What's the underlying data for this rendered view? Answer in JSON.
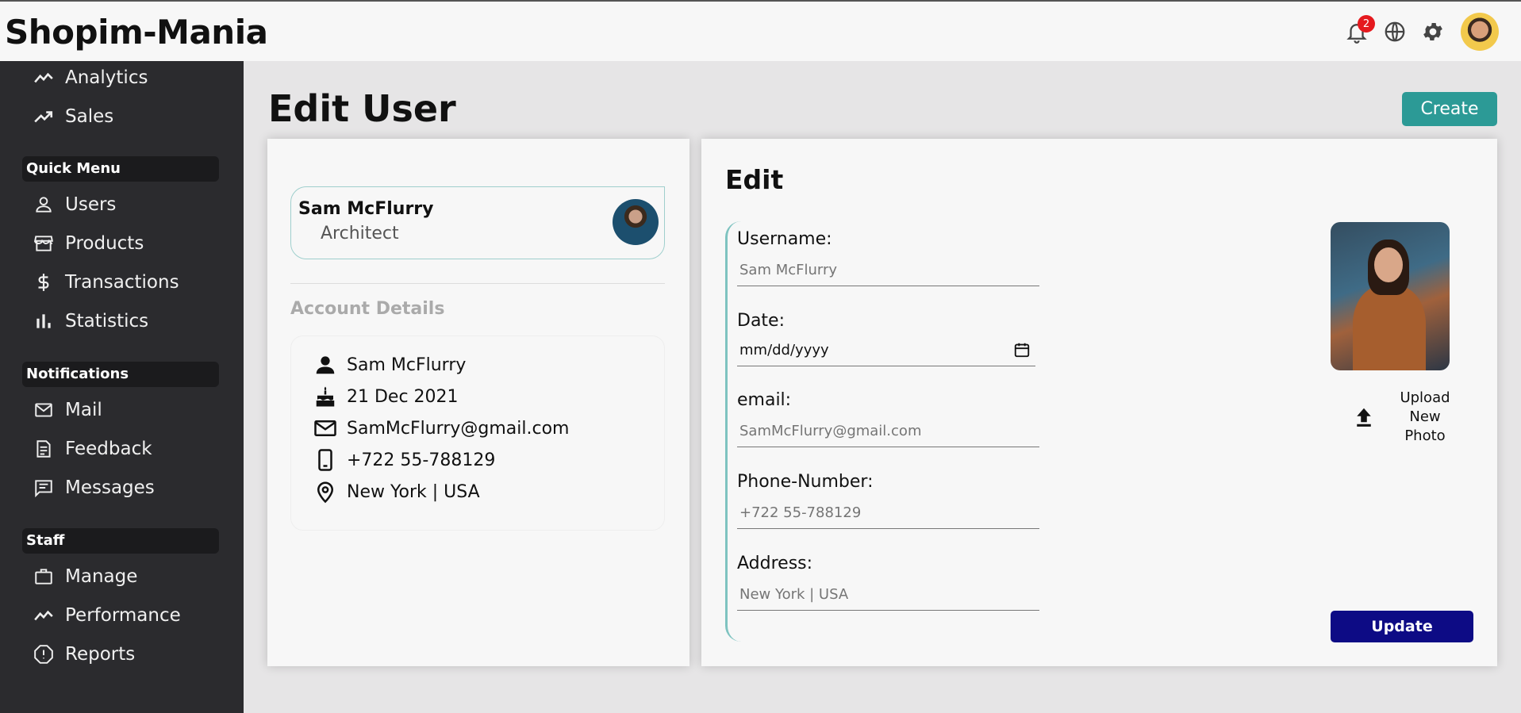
{
  "app": {
    "logo": "Shopim-Mania"
  },
  "topbar": {
    "notifications_badge": "2",
    "icons": [
      "bell-icon",
      "globe-icon",
      "gear-icon",
      "avatar"
    ]
  },
  "sidebar": {
    "dashboard_items": [
      {
        "label": "Analytics",
        "icon": "trending-icon"
      },
      {
        "label": "Sales",
        "icon": "trending-up-icon"
      }
    ],
    "sections": [
      {
        "title": "Quick Menu",
        "items": [
          {
            "label": "Users",
            "icon": "user-icon"
          },
          {
            "label": "Products",
            "icon": "store-icon"
          },
          {
            "label": "Transactions",
            "icon": "dollar-icon"
          },
          {
            "label": "Statistics",
            "icon": "bar-chart-icon"
          }
        ]
      },
      {
        "title": "Notifications",
        "items": [
          {
            "label": "Mail",
            "icon": "mail-icon"
          },
          {
            "label": "Feedback",
            "icon": "feedback-icon"
          },
          {
            "label": "Messages",
            "icon": "chat-icon"
          }
        ]
      },
      {
        "title": "Staff",
        "items": [
          {
            "label": "Manage",
            "icon": "briefcase-icon"
          },
          {
            "label": "Performance",
            "icon": "timeline-icon"
          },
          {
            "label": "Reports",
            "icon": "report-icon"
          }
        ]
      }
    ]
  },
  "page": {
    "title": "Edit User",
    "create_label": "Create"
  },
  "user_card": {
    "name": "Sam McFlurry",
    "role": "Architect"
  },
  "account": {
    "title": "Account Details",
    "rows": [
      {
        "icon": "person-icon",
        "value": "Sam McFlurry"
      },
      {
        "icon": "cake-icon",
        "value": "21 Dec 2021"
      },
      {
        "icon": "mail-icon",
        "value": "SamMcFlurry@gmail.com"
      },
      {
        "icon": "phone-icon",
        "value": "+722 55-788129"
      },
      {
        "icon": "location-icon",
        "value": "New York | USA"
      }
    ]
  },
  "edit": {
    "title": "Edit",
    "fields": [
      {
        "label": "Username:",
        "placeholder": "Sam McFlurry"
      },
      {
        "label": "Date:",
        "placeholder": "mm/dd/yyyy"
      },
      {
        "label": "email:",
        "placeholder": "SamMcFlurry@gmail.com"
      },
      {
        "label": "Phone-Number:",
        "placeholder": "+722 55-788129"
      },
      {
        "label": "Address:",
        "placeholder": "New York | USA"
      }
    ],
    "upload_label": [
      "Upload",
      "New",
      "Photo"
    ],
    "update_label": "Update"
  },
  "colors": {
    "sidebar_bg": "#2b2b2e",
    "accent_teal": "#2c9a96",
    "update_button": "#0d0b85",
    "badge_red": "#e5191e"
  }
}
